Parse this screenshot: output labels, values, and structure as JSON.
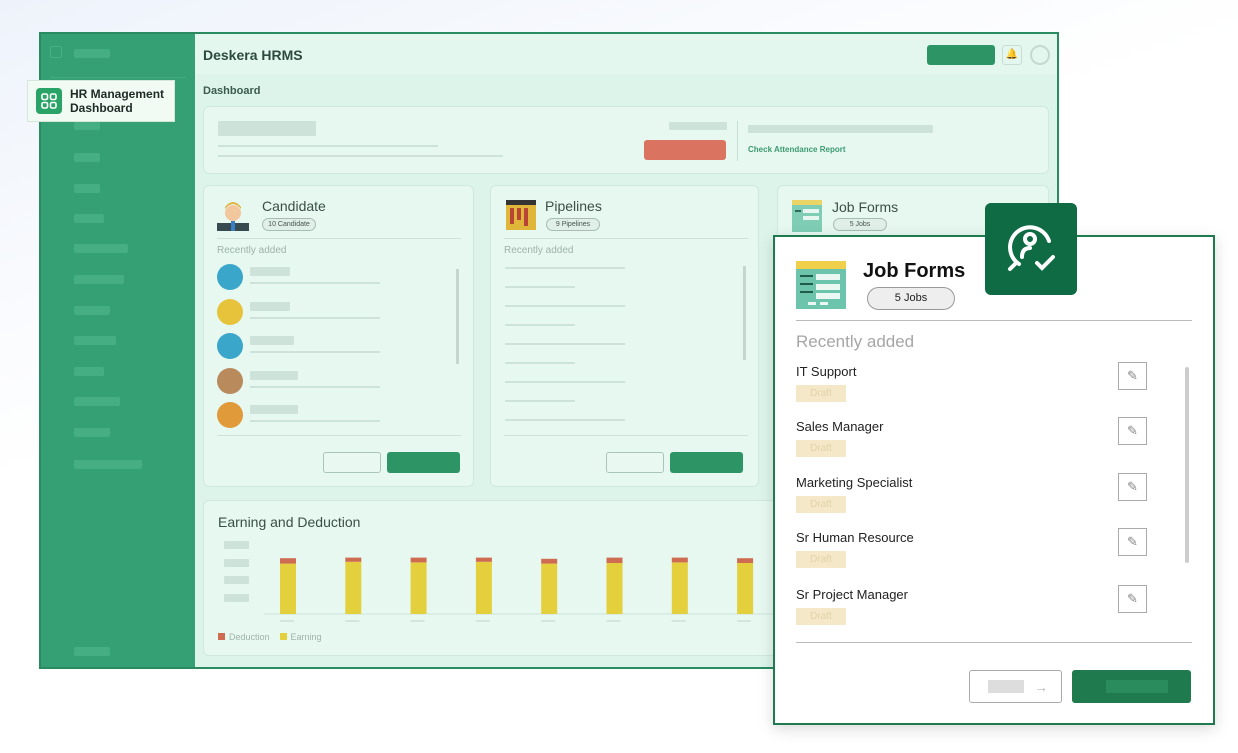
{
  "badge": {
    "label_line1": "HR Management",
    "label_line2": "Dashboard"
  },
  "header": {
    "title": "Deskera HRMS",
    "breadcrumb": "Dashboard"
  },
  "attendance": {
    "link": "Check Attendance Report"
  },
  "candidate": {
    "title": "Candidate",
    "count": "10 Candidate",
    "recent": "Recently added"
  },
  "pipelines": {
    "title": "Pipelines",
    "count": "9 Pipelines",
    "recent": "Recently added"
  },
  "jobforms_bg": {
    "title": "Job Forms",
    "count": "5 Jobs"
  },
  "jobforms": {
    "title": "Job Forms",
    "count": "5 Jobs",
    "recent": "Recently added",
    "items": [
      {
        "name": "IT Support",
        "status": "Draft"
      },
      {
        "name": "Sales Manager",
        "status": "Draft"
      },
      {
        "name": "Marketing Specialist",
        "status": "Draft"
      },
      {
        "name": "Sr Human Resource",
        "status": "Draft"
      },
      {
        "name": "Sr Project Manager",
        "status": "Draft"
      }
    ]
  },
  "colors": {
    "sidebar": "#34a074",
    "accent": "#0e6b44",
    "earning": "#e4cf3c",
    "deduction": "#cf6b50"
  },
  "chart_data": {
    "type": "bar",
    "stacked": true,
    "title": "Earning and Deduction",
    "categories": [
      "",
      "",
      "",
      "",
      "",
      "",
      "",
      ""
    ],
    "series": [
      {
        "name": "Earning",
        "values": [
          84,
          87,
          86,
          87,
          84,
          85,
          86,
          85
        ]
      },
      {
        "name": "Deduction",
        "values": [
          9,
          7,
          8,
          7,
          8,
          9,
          8,
          8
        ]
      }
    ],
    "ylim": [
      0,
      100
    ],
    "legend": "bottom-left"
  }
}
